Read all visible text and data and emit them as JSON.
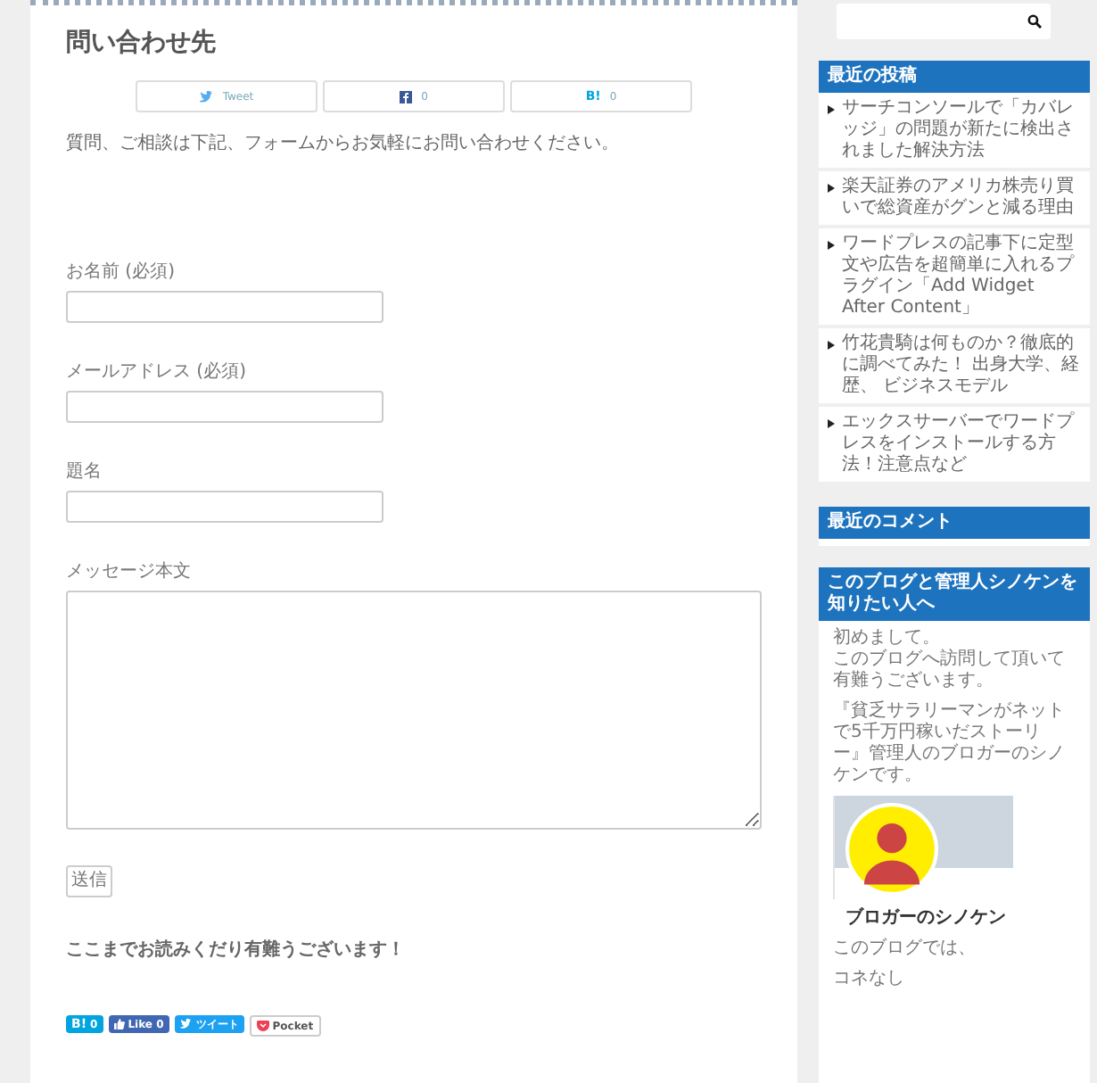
{
  "page": {
    "title": "問い合わせ先",
    "share_buttons": [
      {
        "kind": "twitter",
        "label": "Tweet"
      },
      {
        "kind": "facebook",
        "label": "0"
      },
      {
        "kind": "hatena",
        "icon_text": "B!",
        "label": "0"
      }
    ],
    "intro": "質問、ご相談は下記、フォームからお気軽にお問い合わせください。",
    "form": {
      "fields": [
        {
          "kind": "text",
          "label": "お名前 (必須)"
        },
        {
          "kind": "text",
          "label": "メールアドレス (必須)"
        },
        {
          "kind": "text",
          "label": "題名"
        },
        {
          "kind": "textarea",
          "label": "メッセージ本文"
        }
      ],
      "submit": "送信"
    },
    "closing": "ここまでお読みくだり有難うございます！",
    "social_buttons": [
      {
        "kind": "hatena",
        "icon_text": "B!",
        "label": "0"
      },
      {
        "kind": "like",
        "label": "Like 0"
      },
      {
        "kind": "tweet",
        "label": "ツイート"
      },
      {
        "kind": "pocket",
        "label": "Pocket"
      }
    ]
  },
  "sidebar": {
    "recent_posts": {
      "title": "最近の投稿",
      "items": [
        "サーチコンソールで「カバレッジ」の問題が新たに検出されました解決方法",
        "楽天証券のアメリカ株売り買いで総資産がグンと減る理由",
        "ワードプレスの記事下に定型文や広告を超簡単に入れるプラグイン「Add Widget After Content」",
        "竹花貴騎は何ものか？徹底的に調べてみた！ 出身大学、経歴、 ビジネスモデル",
        "エックスサーバーでワードプレスをインストールする方法！注意点など"
      ]
    },
    "recent_comments": {
      "title": "最近のコメント"
    },
    "about": {
      "title": "このブログと管理人シノケンを知りたい人へ",
      "paragraphs": [
        [
          "初めまして。",
          "このブログへ訪問して頂いて有難うございます。"
        ],
        [
          "『貧乏サラリーマンがネットで5千万円稼いだストーリー』管理人のブロガーのシノケンです。"
        ]
      ],
      "profile_name": "ブロガーのシノケン",
      "after": [
        "このブログでは、",
        "コネなし"
      ]
    }
  }
}
